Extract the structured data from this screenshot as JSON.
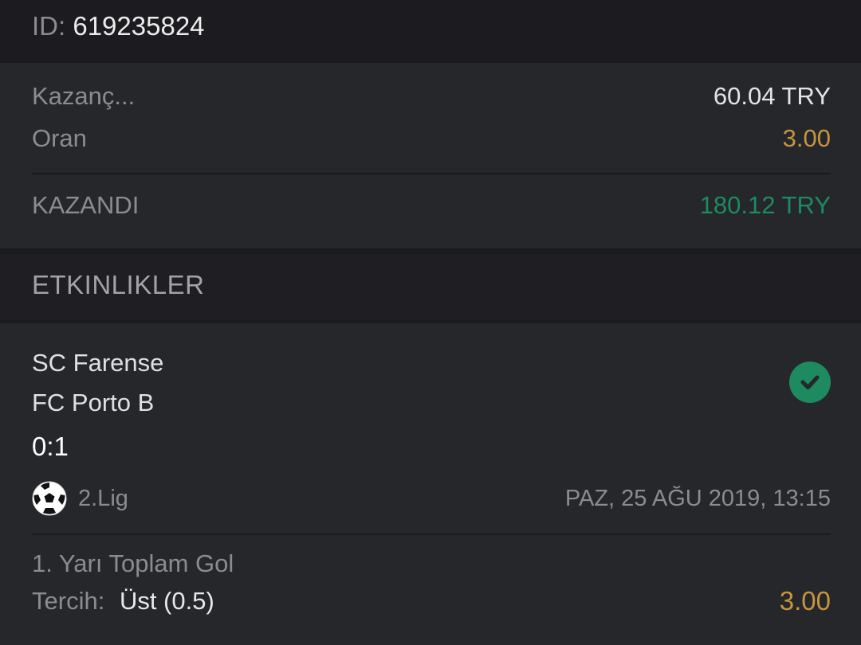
{
  "ticket": {
    "id_label": "ID:",
    "id_value": "619235824"
  },
  "summary": {
    "stake_label": "Kazanç...",
    "stake_value": "60.04 TRY",
    "odds_label": "Oran",
    "odds_value": "3.00",
    "result_label": "KAZANDI",
    "result_value": "180.12 TRY"
  },
  "events": {
    "title": "ETKINLIKLER",
    "items": [
      {
        "home_team": "SC Farense",
        "away_team": "FC Porto B",
        "score": "0:1",
        "league_icon": "soccer-ball-icon",
        "status_icon": "check-circle-icon",
        "league": "2.Lig",
        "datetime": "PAZ, 25 AĞU 2019, 13:15",
        "market": "1. Yarı Toplam Gol",
        "pick_label": "Tercih:",
        "pick_value": "Üst (0.5)",
        "pick_odds": "3.00"
      }
    ]
  },
  "colors": {
    "background": "#1b1b1f",
    "panel": "#26272b",
    "odds": "#c8953e",
    "win": "#1d8a5f",
    "muted_text": "#8c8c8f"
  }
}
